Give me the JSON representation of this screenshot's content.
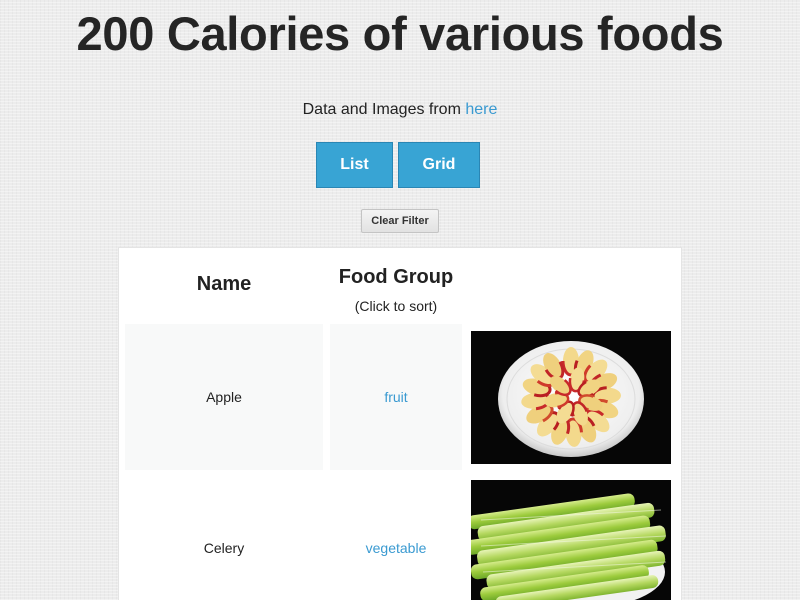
{
  "page": {
    "title": "200 Calories of various foods",
    "credit_text": "Data and Images from ",
    "credit_link": "here"
  },
  "controls": {
    "list_label": "List",
    "grid_label": "Grid",
    "clear_filter_label": "Clear Filter"
  },
  "colors": {
    "accent": "#38a4d4",
    "link": "#3a9ad1",
    "background": "#ececec"
  },
  "table": {
    "headers": {
      "name": "Name",
      "food_group": "Food Group",
      "sort_hint": "(Click to sort)"
    },
    "rows": [
      {
        "name": "Apple",
        "food_group": "fruit",
        "image": "apple-slices-plate-photo"
      },
      {
        "name": "Celery",
        "food_group": "vegetable",
        "image": "celery-stalks-plate-photo"
      }
    ]
  }
}
